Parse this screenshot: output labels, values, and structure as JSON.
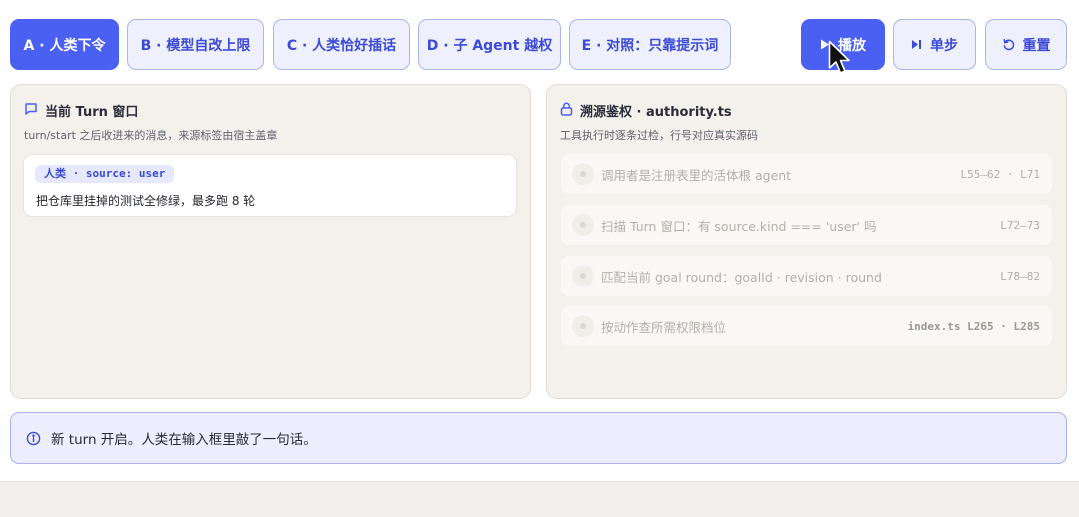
{
  "toolbar": {
    "scenarios": [
      {
        "label": "A · 人类下令",
        "active": true
      },
      {
        "label": "B · 模型自改上限",
        "active": false
      },
      {
        "label": "C · 人类恰好插话",
        "active": false
      },
      {
        "label": "D · 子 Agent 越权",
        "active": false
      },
      {
        "label": "E · 对照：只靠提示词",
        "active": false
      }
    ],
    "play_label": "播放",
    "step_label": "单步",
    "reset_label": "重置"
  },
  "turn_panel": {
    "title": "当前 Turn 窗口",
    "subtitle": "turn/start 之后收进来的消息，来源标签由宿主盖章",
    "message": {
      "tag": "人类 · source: user",
      "text": "把仓库里挂掉的测试全修绿，最多跑 8 轮"
    }
  },
  "authority_panel": {
    "title": "溯源鉴权 · authority.ts",
    "subtitle": "工具执行时逐条过检，行号对应真实源码",
    "checks": [
      {
        "label": "调用者是注册表里的活体根 agent",
        "ref": "L55–62 · L71"
      },
      {
        "label": "扫描 Turn 窗口：有 source.kind === 'user' 吗",
        "ref": "L72–73"
      },
      {
        "label": "匹配当前 goal round：goalId · revision · round",
        "ref": "L78–82"
      },
      {
        "label": "按动作查所需权限档位",
        "ref": "index.ts L265 · L285"
      }
    ]
  },
  "status": {
    "text": "新 turn 开启。人类在输入框里敲了一句话。"
  },
  "colors": {
    "accent": "#4960f2",
    "accent_light": "#eef0fd",
    "panel_bg": "#f4f1ec",
    "status_bg": "#eceefd"
  },
  "icons": {
    "play": "play-icon",
    "step": "step-forward-icon",
    "reset": "rotate-ccw-icon",
    "chat": "message-square-icon",
    "lock": "lock-icon",
    "info": "info-icon",
    "cursor": "mouse-pointer-icon"
  }
}
